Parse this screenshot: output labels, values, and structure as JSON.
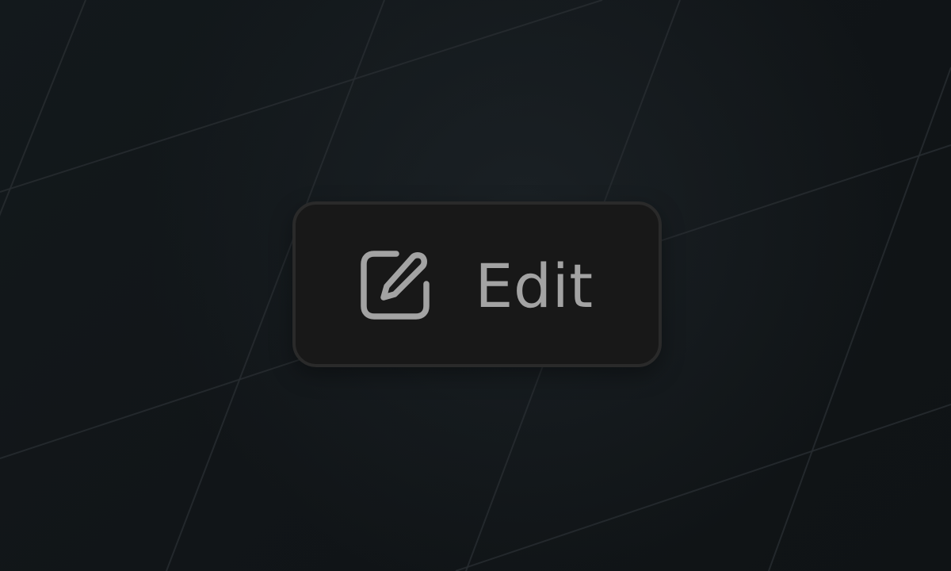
{
  "button": {
    "label": "Edit",
    "icon": "edit-icon"
  },
  "colors": {
    "background": "#111518",
    "grid_line": "#272c30",
    "button_background": "#181818",
    "button_border": "#2a2a2a",
    "button_text": "#a3a3a3"
  }
}
